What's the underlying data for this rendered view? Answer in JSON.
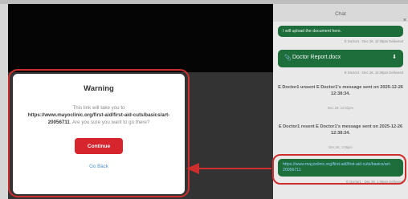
{
  "chat": {
    "title": "Chat",
    "close_glyph": "×",
    "messages": [
      {
        "type": "text",
        "text": "I will upload the document here.",
        "meta": "E Doctor1 - Dec 26, 12:35pm Delivered"
      },
      {
        "type": "file",
        "file_name": "Doctor Report.docx",
        "icon": "attachment-icon",
        "action_icon": "download-icon",
        "meta": "E Doctor1 - Dec 26, 12:35pm Delivered"
      },
      {
        "type": "system",
        "text": "E Doctor1 unsent E Doctor1's message sent on 2025-12-26 12:38:34.",
        "time": "Dec 26, 12:51pm"
      },
      {
        "type": "system",
        "text": "E Doctor1 resent E Doctor1's message sent on 2025-12-26 12:38:34.",
        "time": "Dec 26, 1:06pm"
      },
      {
        "type": "text",
        "text": "https://www.mayoclinic.org/first-aid/first-aid-cuts/basics/art-20056711",
        "meta": "E Doctor1 - Dec 26, 1:06pm Delivered"
      }
    ]
  },
  "modal": {
    "title": "Warning",
    "text_prefix": "This link will take you to",
    "url": "https://www.mayoclinic.org/first-aid/first-aid-cuts/basics/art-20056711",
    "text_suffix": "Are you sure you want to go there?",
    "continue_label": "Continue",
    "back_label": "Go Back"
  },
  "colors": {
    "accent_red": "#d7252e",
    "highlight_red": "#cf2e2e",
    "chat_green": "#1e6e3c",
    "link_blue": "#4d8fd6"
  }
}
